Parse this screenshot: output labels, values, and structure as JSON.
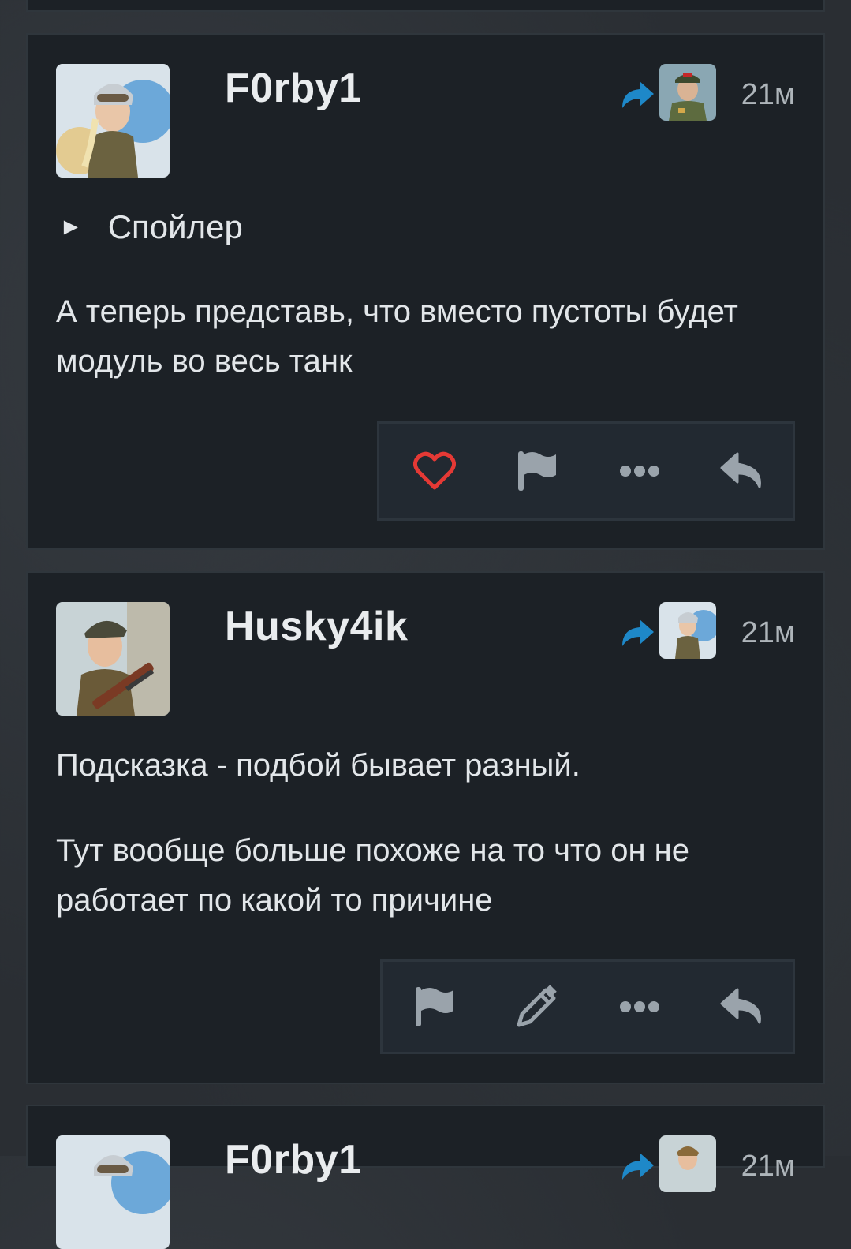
{
  "posts": [
    {
      "username": "F0rby1",
      "time": "21м",
      "spoiler_label": "Спойлер",
      "paragraphs": [
        "А теперь представь, что вместо пустоты будет модуль во весь танк"
      ],
      "actions": [
        "heart-icon",
        "flag-icon",
        "more-icon",
        "reply-icon"
      ]
    },
    {
      "username": "Husky4ik",
      "time": "21м",
      "paragraphs": [
        "Подсказка - подбой бывает разный.",
        "Тут вообще больше похоже на то что он не работает по какой то причине"
      ],
      "actions": [
        "flag-icon",
        "edit-icon",
        "more-icon",
        "reply-icon"
      ]
    },
    {
      "username": "F0rby1",
      "time": "21м"
    }
  ],
  "colors": {
    "accent_blue": "#1e88c8",
    "heart_red": "#e53935",
    "icon_grey": "#9aa3ab"
  }
}
